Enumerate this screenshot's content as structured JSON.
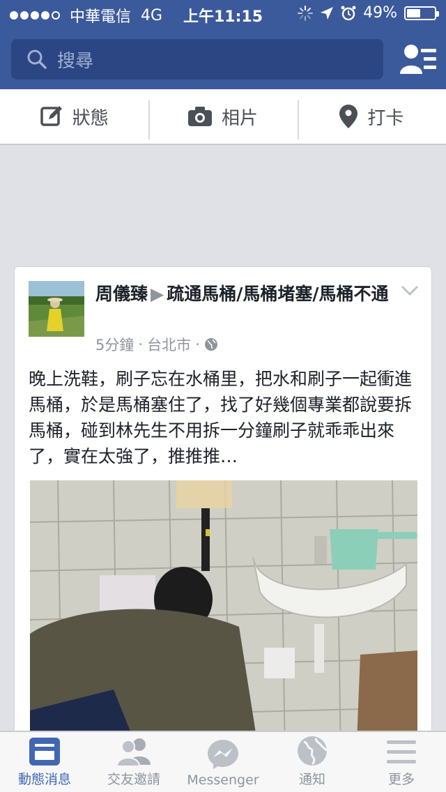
{
  "status_bar": {
    "carrier": "中華電信",
    "network": "4G",
    "time": "上午11:15",
    "battery": "49%",
    "battery_level": 0.49
  },
  "search": {
    "placeholder": "搜尋"
  },
  "actions": [
    {
      "label": "狀態",
      "icon": "compose-icon"
    },
    {
      "label": "相片",
      "icon": "camera-icon"
    },
    {
      "label": "打卡",
      "icon": "location-pin-icon"
    }
  ],
  "post": {
    "author": "周儀臻",
    "page": "疏通馬桶/馬桶堵塞/馬桶不通",
    "time": "5分鐘",
    "location": "台北市",
    "text": "晚上洗鞋，刷子忘在水桶里，把水和刷子一起衝進馬桶，於是馬桶塞住了，找了好幾個專業都說要拆馬桶，碰到林先生不用拆一分鐘刷子就乖乖出來了，實在太強了，推推推…"
  },
  "tabs": [
    {
      "label": "動態消息",
      "active": true
    },
    {
      "label": "交友邀請",
      "active": false
    },
    {
      "label": "Messenger",
      "active": false
    },
    {
      "label": "通知",
      "active": false
    },
    {
      "label": "更多",
      "active": false
    }
  ],
  "colors": {
    "brand": "#3b5a9b",
    "active_tab": "#4167b2"
  }
}
